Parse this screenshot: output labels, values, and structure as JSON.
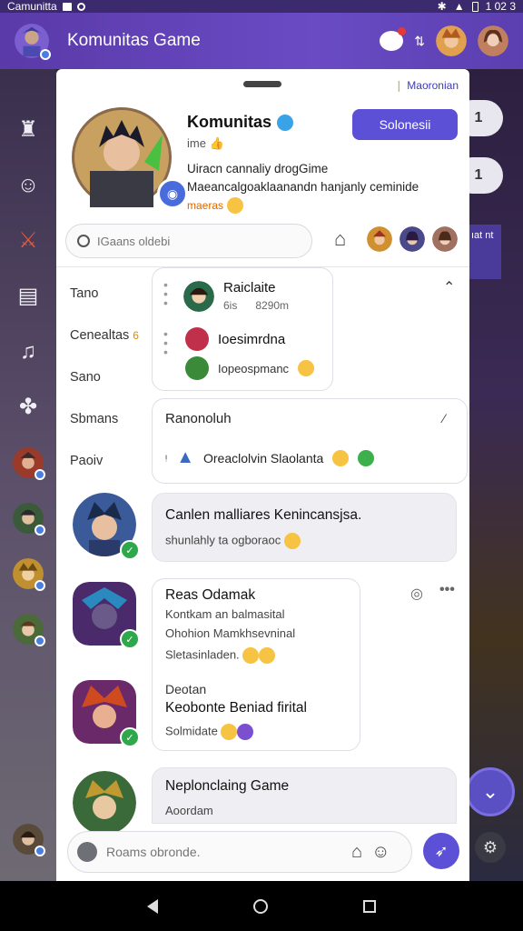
{
  "status_bar": {
    "app_name": "Camunitta",
    "time": "1 02 3"
  },
  "header": {
    "title": "Komunitas Game"
  },
  "colors": {
    "accent": "#5b50d6",
    "header": "#5a3aa8",
    "online": "#2ea84a"
  },
  "right_edge": {
    "pill_1": "1",
    "pill_2": "1",
    "panel_text": "ıat nt"
  },
  "sheet": {
    "locale": "Maoronian",
    "profile": {
      "name": "Komunitas",
      "subtitle": "ime",
      "description": "Uiracn cannaliy drogGime Maeancalgoaklaanandn hanjanly ceminide",
      "tag": "maeras",
      "cta": "Solonesii"
    },
    "search": {
      "placeholder": "IGaans oldebi"
    },
    "tabs": [
      "Tano",
      "Cenealtas",
      "Sano",
      "Sbmans",
      "Paoiv"
    ],
    "tab_badge": "6",
    "dropdown": {
      "items": [
        {
          "name": "Raiclaite",
          "meta_left": "6is",
          "meta_right": "8290m"
        },
        {
          "name": "Ioesimrdna"
        },
        {
          "name": "Iopeospmanc"
        }
      ]
    },
    "info_card": {
      "title": "Ranonoluh",
      "item": "Oreaclolvin Slaolanta"
    },
    "messages": [
      {
        "title": "Canlen malliares Kenincansjsa.",
        "sub": "shunlahly ta ogboraoc"
      },
      {
        "title": "Reas Odamak",
        "line2": "Kontkam an balmasital",
        "line3": "Ohohion Mamkhsevninal",
        "line4": "Sletasinladen."
      },
      {
        "title": "Deotan",
        "line2": "Keobonte Beniad firital",
        "line3": "Solmidate"
      },
      {
        "title": "Neplonclaing Game",
        "sub": "Aoordam"
      }
    ],
    "composer": {
      "placeholder": "Roams obronde."
    }
  }
}
